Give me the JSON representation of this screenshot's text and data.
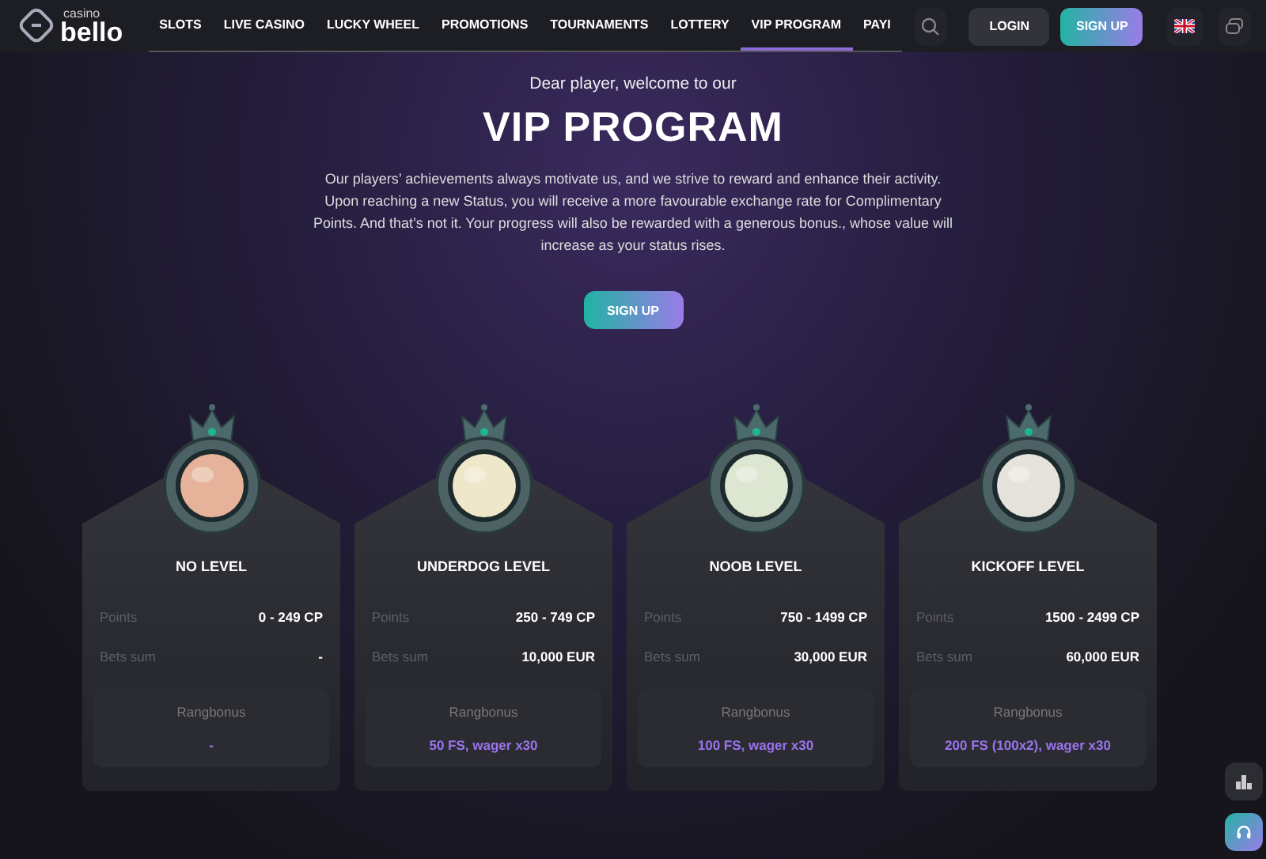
{
  "header": {
    "logo": {
      "small": "casino",
      "big": "bello"
    },
    "nav": [
      {
        "label": "SLOTS",
        "selected": false
      },
      {
        "label": "LIVE CASINO",
        "selected": false
      },
      {
        "label": "LUCKY WHEEL",
        "selected": false
      },
      {
        "label": "PROMOTIONS",
        "selected": false
      },
      {
        "label": "TOURNAMENTS",
        "selected": false
      },
      {
        "label": "LOTTERY",
        "selected": false
      },
      {
        "label": "VIP PROGRAM",
        "selected": true
      },
      {
        "label": "PAYI",
        "selected": false
      }
    ],
    "login": "LOGIN",
    "signup": "SIGN UP"
  },
  "hero": {
    "greeting": "Dear player, welcome to our",
    "title": "VIP PROGRAM",
    "text": "Our players’ achievements always motivate us, and we strive to reward and enhance their activity. Upon reaching a new Status, you will receive a more favourable exchange rate for Complimentary Points. And that’s not it. Your progress will also be rewarded with a generous bonus., whose value will increase as your status rises.",
    "signup": "SIGN UP"
  },
  "levels": [
    {
      "name": "NO LEVEL",
      "color": "#e6b39a",
      "points_label": "Points",
      "points": "0 - 249 CP",
      "bets_label": "Bets sum",
      "bets": "-",
      "bonus_label": "Rangbonus",
      "bonus": "-"
    },
    {
      "name": "UNDERDOG LEVEL",
      "color": "#efe7c9",
      "points_label": "Points",
      "points": "250 - 749 CP",
      "bets_label": "Bets sum",
      "bets": "10,000 EUR",
      "bonus_label": "Rangbonus",
      "bonus": "50 FS, wager x30"
    },
    {
      "name": "NOOB LEVEL",
      "color": "#dde6d0",
      "points_label": "Points",
      "points": "750 - 1499 CP",
      "bets_label": "Bets sum",
      "bets": "30,000 EUR",
      "bonus_label": "Rangbonus",
      "bonus": "100 FS, wager x30"
    },
    {
      "name": "KICKOFF LEVEL",
      "color": "#e6e3dc",
      "points_label": "Points",
      "points": "1500 - 2499 CP",
      "bets_label": "Bets sum",
      "bets": "60,000 EUR",
      "bonus_label": "Rangbonus",
      "bonus": "200 FS (100x2), wager x30"
    }
  ]
}
